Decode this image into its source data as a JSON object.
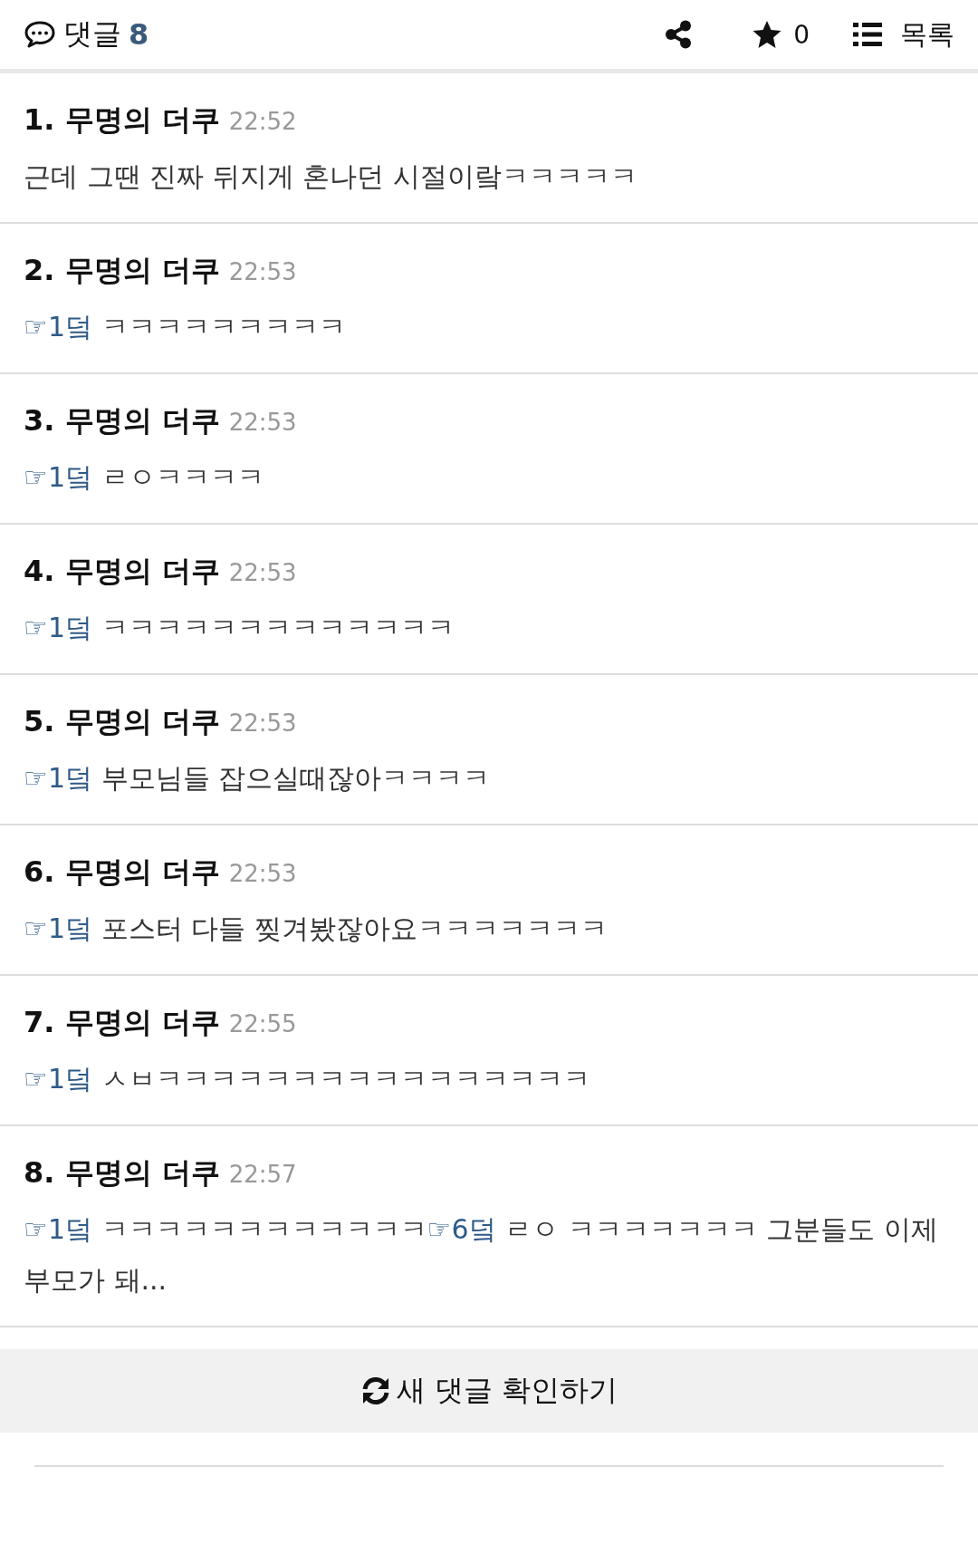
{
  "header": {
    "comments_label": "댓글",
    "comments_count": "8",
    "stars_count": "0",
    "list_label": "목록"
  },
  "comments": [
    {
      "number": "1.",
      "author": "무명의 더쿠",
      "time": "22:52",
      "body": [
        {
          "kind": "text",
          "text": "근데 그땐 진짜 뒤지게 혼나던 시절이랔ㅋㅋㅋㅋㅋ"
        }
      ]
    },
    {
      "number": "2.",
      "author": "무명의 더쿠",
      "time": "22:53",
      "body": [
        {
          "kind": "reply",
          "text": "☞1덬"
        },
        {
          "kind": "text",
          "text": " ㅋㅋㅋㅋㅋㅋㅋㅋㅋ"
        }
      ]
    },
    {
      "number": "3.",
      "author": "무명의 더쿠",
      "time": "22:53",
      "body": [
        {
          "kind": "reply",
          "text": "☞1덬"
        },
        {
          "kind": "text",
          "text": " ㄹㅇㅋㅋㅋㅋ"
        }
      ]
    },
    {
      "number": "4.",
      "author": "무명의 더쿠",
      "time": "22:53",
      "body": [
        {
          "kind": "reply",
          "text": "☞1덬"
        },
        {
          "kind": "text",
          "text": " ㅋㅋㅋㅋㅋㅋㅋㅋㅋㅋㅋㅋㅋ"
        }
      ]
    },
    {
      "number": "5.",
      "author": "무명의 더쿠",
      "time": "22:53",
      "body": [
        {
          "kind": "reply",
          "text": "☞1덬"
        },
        {
          "kind": "text",
          "text": " 부모님들 잡으실때잖아ㅋㅋㅋㅋ"
        }
      ]
    },
    {
      "number": "6.",
      "author": "무명의 더쿠",
      "time": "22:53",
      "body": [
        {
          "kind": "reply",
          "text": "☞1덬"
        },
        {
          "kind": "text",
          "text": " 포스터 다들 찢겨봤잖아요ㅋㅋㅋㅋㅋㅋㅋ"
        }
      ]
    },
    {
      "number": "7.",
      "author": "무명의 더쿠",
      "time": "22:55",
      "body": [
        {
          "kind": "reply",
          "text": "☞1덬"
        },
        {
          "kind": "text",
          "text": " ㅅㅂㅋㅋㅋㅋㅋㅋㅋㅋㅋㅋㅋㅋㅋㅋㅋㅋ"
        }
      ]
    },
    {
      "number": "8.",
      "author": "무명의 더쿠",
      "time": "22:57",
      "body": [
        {
          "kind": "reply",
          "text": "☞1덬"
        },
        {
          "kind": "text",
          "text": " ㅋㅋㅋㅋㅋㅋㅋㅋㅋㅋㅋㅋ"
        },
        {
          "kind": "reply",
          "text": "☞6덬"
        },
        {
          "kind": "text",
          "text": " ㄹㅇ ㅋㅋㅋㅋㅋㅋㅋ 그분들도 이제 부모가 돼..."
        }
      ]
    }
  ],
  "refresh_button": "새 댓글 확인하기"
}
